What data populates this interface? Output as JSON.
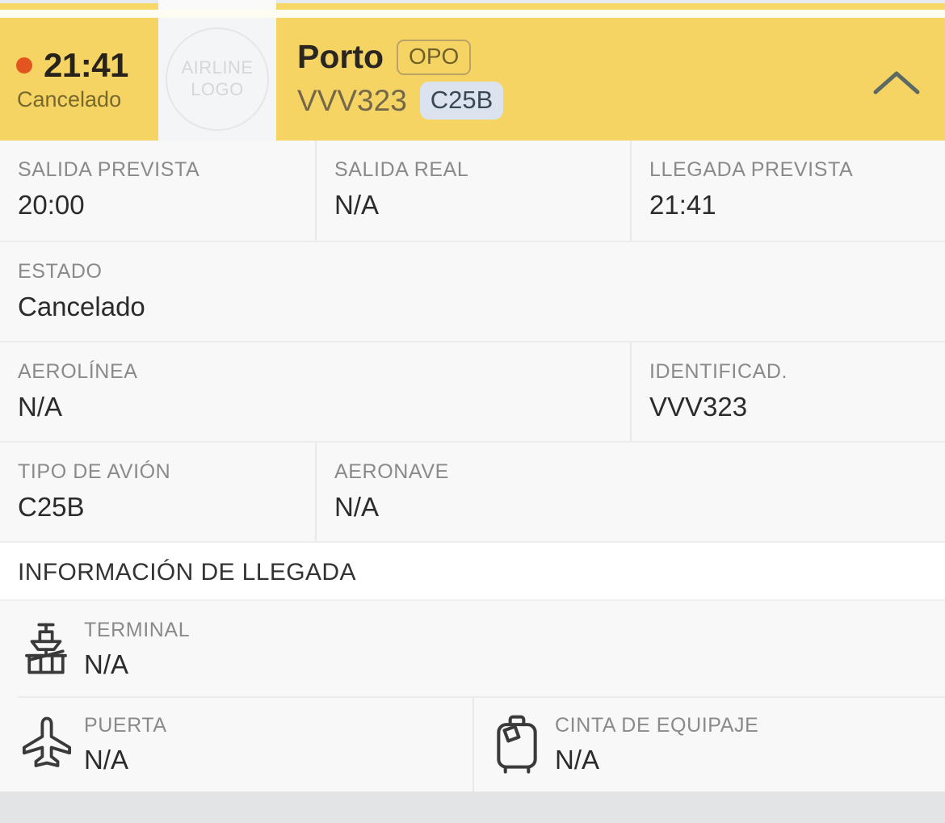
{
  "header": {
    "time": "21:41",
    "status_label": "Cancelado",
    "logo_placeholder_line1": "AIRLINE",
    "logo_placeholder_line2": "LOGO",
    "city": "Porto",
    "iata_code": "OPO",
    "flight_number": "VVV323",
    "equipment_code": "C25B",
    "toggle_icon": "chevron-up-icon",
    "status_dot_color": "#e2551f",
    "background_color": "#f6d464"
  },
  "details": {
    "times_row": [
      {
        "label": "SALIDA PREVISTA",
        "value": "20:00"
      },
      {
        "label": "SALIDA REAL",
        "value": "N/A"
      },
      {
        "label": "LLEGADA PREVISTA",
        "value": "21:41"
      }
    ],
    "status_row": [
      {
        "label": "ESTADO",
        "value": "Cancelado"
      }
    ],
    "airline_row": [
      {
        "label": "AEROLÍNEA",
        "value": "N/A"
      },
      {
        "label": "IDENTIFICAD.",
        "value": "VVV323"
      }
    ],
    "aircraft_row": [
      {
        "label": "TIPO DE AVIÓN",
        "value": "C25B"
      },
      {
        "label": "AERONAVE",
        "value": "N/A"
      }
    ]
  },
  "arrival_section": {
    "title": "INFORMACIÓN DE LLEGADA",
    "terminal": {
      "icon": "control-tower-icon",
      "label": "TERMINAL",
      "value": "N/A"
    },
    "gate": {
      "icon": "airplane-icon",
      "label": "PUERTA",
      "value": "N/A"
    },
    "baggage": {
      "icon": "suitcase-icon",
      "label": "CINTA DE EQUIPAJE",
      "value": "N/A"
    }
  }
}
